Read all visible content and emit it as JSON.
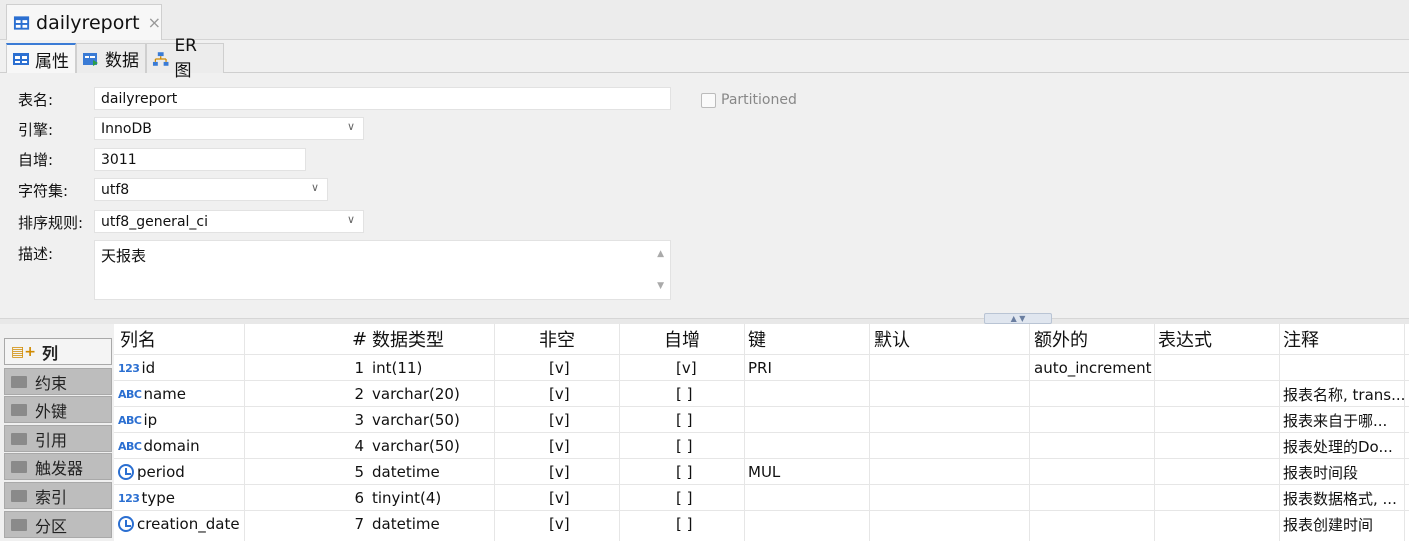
{
  "editor_tab": {
    "title": "dailyreport",
    "close": "×"
  },
  "sub_tabs": [
    {
      "label": "属性"
    },
    {
      "label": "数据"
    },
    {
      "label": "ER 图"
    }
  ],
  "form": {
    "table_name_label": "表名:",
    "table_name_value": "dailyreport",
    "engine_label": "引擎:",
    "engine_value": "InnoDB",
    "auto_inc_label": "自增:",
    "auto_inc_value": "3011",
    "charset_label": "字符集:",
    "charset_value": "utf8",
    "collation_label": "排序规则:",
    "collation_value": "utf8_general_ci",
    "description_label": "描述:",
    "description_value": "天报表",
    "partitioned_label": "Partitioned",
    "partitioned_checked": false
  },
  "left_nav": [
    {
      "label": "列",
      "active": true
    },
    {
      "label": "约束"
    },
    {
      "label": "外键"
    },
    {
      "label": "引用"
    },
    {
      "label": "触发器"
    },
    {
      "label": "索引"
    },
    {
      "label": "分区"
    }
  ],
  "grid": {
    "headers": [
      "列名",
      "#",
      "数据类型",
      "非空",
      "自增",
      "键",
      "默认",
      "额外的",
      "表达式",
      "注释"
    ],
    "rows": [
      {
        "icon": "123",
        "name": "id",
        "num": "1",
        "type": "int(11)",
        "notnull": "[v]",
        "autoinc": "[v]",
        "key": "PRI",
        "default": "",
        "extra": "auto_increment",
        "expr": "",
        "comment": ""
      },
      {
        "icon": "ABC",
        "name": "name",
        "num": "2",
        "type": "varchar(20)",
        "notnull": "[v]",
        "autoinc": "[ ]",
        "key": "",
        "default": "",
        "extra": "",
        "expr": "",
        "comment": "报表名称, trans..."
      },
      {
        "icon": "ABC",
        "name": "ip",
        "num": "3",
        "type": "varchar(50)",
        "notnull": "[v]",
        "autoinc": "[ ]",
        "key": "",
        "default": "",
        "extra": "",
        "expr": "",
        "comment": "报表来自于哪..."
      },
      {
        "icon": "ABC",
        "name": "domain",
        "num": "4",
        "type": "varchar(50)",
        "notnull": "[v]",
        "autoinc": "[ ]",
        "key": "",
        "default": "",
        "extra": "",
        "expr": "",
        "comment": "报表处理的Do..."
      },
      {
        "icon": "clock",
        "name": "period",
        "num": "5",
        "type": "datetime",
        "notnull": "[v]",
        "autoinc": "[ ]",
        "key": "MUL",
        "default": "",
        "extra": "",
        "expr": "",
        "comment": "报表时间段"
      },
      {
        "icon": "123",
        "name": "type",
        "num": "6",
        "type": "tinyint(4)",
        "notnull": "[v]",
        "autoinc": "[ ]",
        "key": "",
        "default": "",
        "extra": "",
        "expr": "",
        "comment": "报表数据格式, ..."
      },
      {
        "icon": "clock",
        "name": "creation_date",
        "num": "7",
        "type": "datetime",
        "notnull": "[v]",
        "autoinc": "[ ]",
        "key": "",
        "default": "",
        "extra": "",
        "expr": "",
        "comment": "报表创建时间"
      }
    ]
  },
  "colors": {
    "accent": "#2b6fd1",
    "nav_inactive": "#bdbdbd"
  }
}
